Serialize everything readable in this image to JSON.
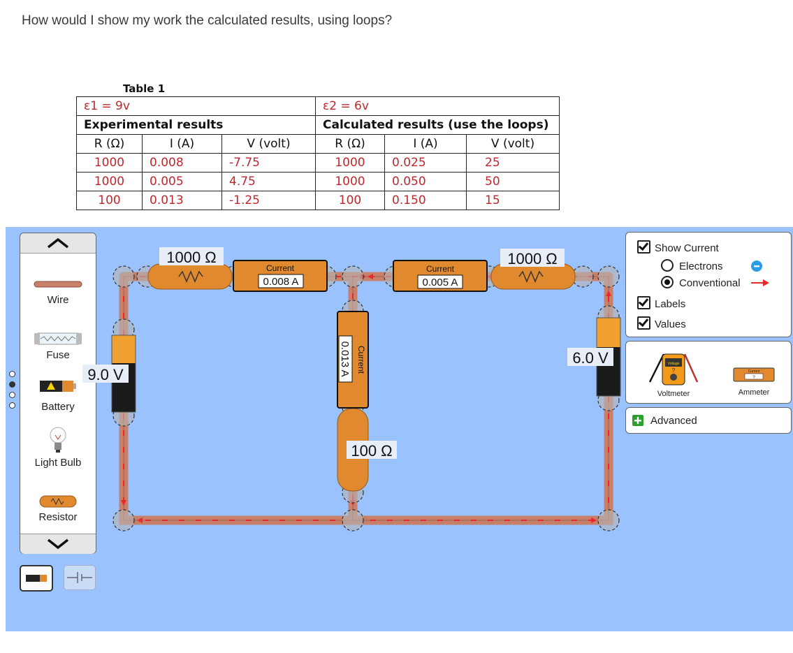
{
  "question": "How would I show my work the calculated results, using loops?",
  "table": {
    "caption": "Table 1",
    "emf1": "ε1 = 9v",
    "emf2": "ε2 = 6v",
    "experimental_title": "Experimental results",
    "calculated_title": "Calculated results (use the loops)",
    "col_r": "R (Ω)",
    "col_i": "I (A)",
    "col_v": "V (volt)",
    "rows": [
      {
        "r1": "1000",
        "i1": "0.008",
        "v1": "-7.75",
        "r2": "1000",
        "i2": "0.025",
        "v2": "25"
      },
      {
        "r1": "1000",
        "i1": "0.005",
        "v1": "4.75",
        "r2": "1000",
        "i2": "0.050",
        "v2": "50"
      },
      {
        "r1": "100",
        "i1": "0.013",
        "v1": "-1.25",
        "r2": "100",
        "i2": "0.150",
        "v2": "15"
      }
    ]
  },
  "palette": {
    "items": [
      "Wire",
      "Fuse",
      "Battery",
      "Light Bulb",
      "Resistor"
    ]
  },
  "circuit": {
    "resistor_left": "1000 Ω",
    "resistor_right": "1000 Ω",
    "resistor_middle": "100 Ω",
    "battery_left": "9.0 V",
    "battery_right": "6.0 V",
    "ammeter_title": "Current",
    "ammeter_left": "0.008 A",
    "ammeter_right": "0.005 A",
    "ammeter_middle": "0.013 A"
  },
  "controls": {
    "show_current": "Show Current",
    "electrons": "Electrons",
    "conventional": "Conventional",
    "labels": "Labels",
    "values": "Values",
    "voltmeter": "Voltmeter",
    "ammeter": "Ammeter",
    "voltmeter_face": "Voltage",
    "ammeter_face": "Current",
    "meter_unknown": "?",
    "advanced": "Advanced"
  },
  "colors": {
    "background": "#99c2ff",
    "wire": "#c8806a",
    "component": "#e0892f",
    "current_arrow": "#e8282b"
  }
}
